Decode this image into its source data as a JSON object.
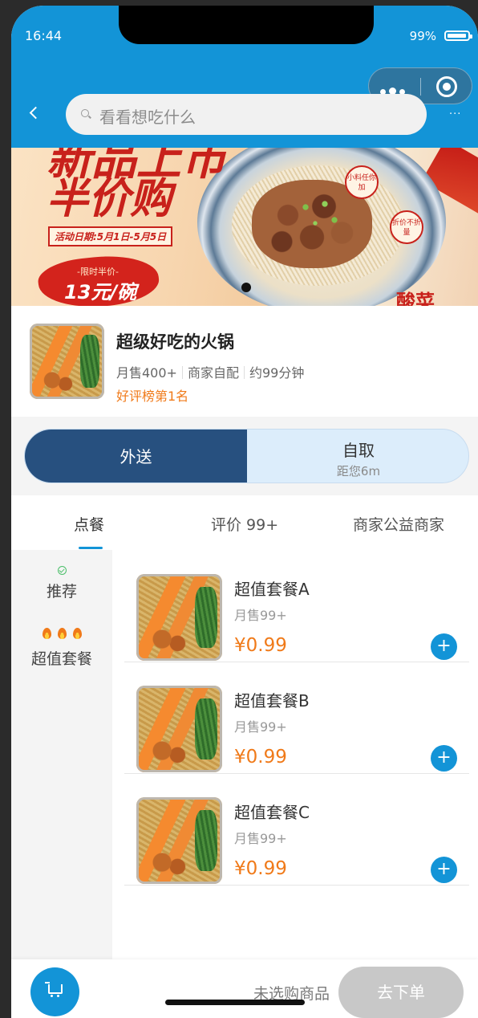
{
  "status": {
    "time": "16:44",
    "battery": "99%"
  },
  "nav": {
    "search_placeholder": "看看想吃什么",
    "more_label": "···"
  },
  "banner": {
    "title_line1": "新品上市",
    "title_line2": "半价购",
    "date_text": "活动日期:5月1日-5月5日",
    "burst_sub": "-限时半价-",
    "burst_main": "13元/碗",
    "badge1": "小料任你加",
    "badge2": "折价不折量",
    "corner_text": "酸菜"
  },
  "shop": {
    "name": "超级好吃的火锅",
    "monthly_sales": "月售400+",
    "delivery_mode": "商家自配",
    "delivery_time": "约99分钟",
    "rank": "好评榜第1名"
  },
  "delivery_toggle": {
    "active": "外送",
    "pickup_label": "自取",
    "pickup_distance": "距您6m"
  },
  "tabs": [
    {
      "label": "点餐",
      "active": true
    },
    {
      "label": "评价 99+",
      "active": false
    },
    {
      "label": "商家公益商家",
      "active": false
    }
  ],
  "categories": [
    {
      "label": "推荐",
      "active": true
    },
    {
      "label": "超值套餐",
      "active": false
    }
  ],
  "items": [
    {
      "name": "超值套餐A",
      "sales": "月售99+",
      "price": "¥0.99"
    },
    {
      "name": "超值套餐B",
      "sales": "月售99+",
      "price": "¥0.99"
    },
    {
      "name": "超值套餐C",
      "sales": "月售99+",
      "price": "¥0.99"
    }
  ],
  "add_label": "+",
  "cart": {
    "empty_text": "未选购商品",
    "order_label": "去下单"
  },
  "colors": {
    "primary": "#1394d7",
    "accent": "#f07a19",
    "deliver_active": "#27507f"
  }
}
